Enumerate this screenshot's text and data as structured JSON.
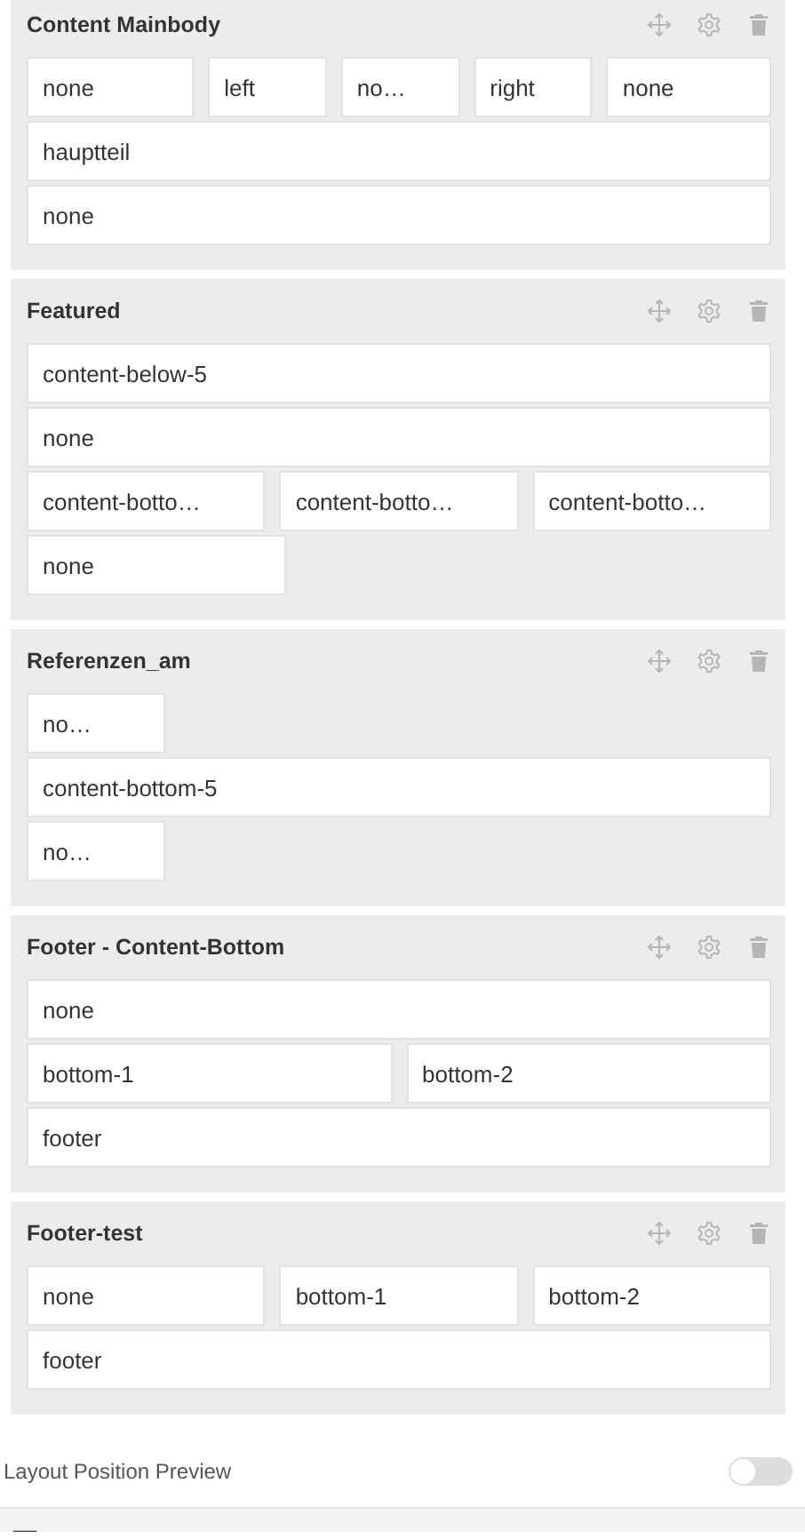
{
  "sections": [
    {
      "title": "Content Mainbody",
      "rows": [
        {
          "cells": [
            "none",
            "left",
            "no…",
            "right",
            "none"
          ]
        },
        {
          "cells": [
            "hauptteil"
          ]
        },
        {
          "cells": [
            "none"
          ]
        }
      ]
    },
    {
      "title": "Featured",
      "rows": [
        {
          "cells": [
            "content-below-5"
          ]
        },
        {
          "cells": [
            "none"
          ]
        },
        {
          "cells": [
            "content-botto…",
            "content-botto…",
            "content-botto…"
          ]
        },
        {
          "cells": [
            "none"
          ]
        }
      ]
    },
    {
      "title": "Referenzen_am",
      "rows": [
        {
          "cells": [
            "no…"
          ]
        },
        {
          "cells": [
            "content-bottom-5"
          ]
        },
        {
          "cells": [
            "no…"
          ]
        }
      ]
    },
    {
      "title": "Footer - Content-Bottom",
      "rows": [
        {
          "cells": [
            "none"
          ]
        },
        {
          "cells": [
            "bottom-1",
            "bottom-2"
          ]
        },
        {
          "cells": [
            "footer"
          ]
        }
      ]
    },
    {
      "title": "Footer-test",
      "rows": [
        {
          "cells": [
            "none",
            "bottom-1",
            "bottom-2"
          ]
        },
        {
          "cells": [
            "footer"
          ]
        }
      ]
    }
  ],
  "preview": {
    "label": "Layout Position Preview",
    "on": false
  }
}
